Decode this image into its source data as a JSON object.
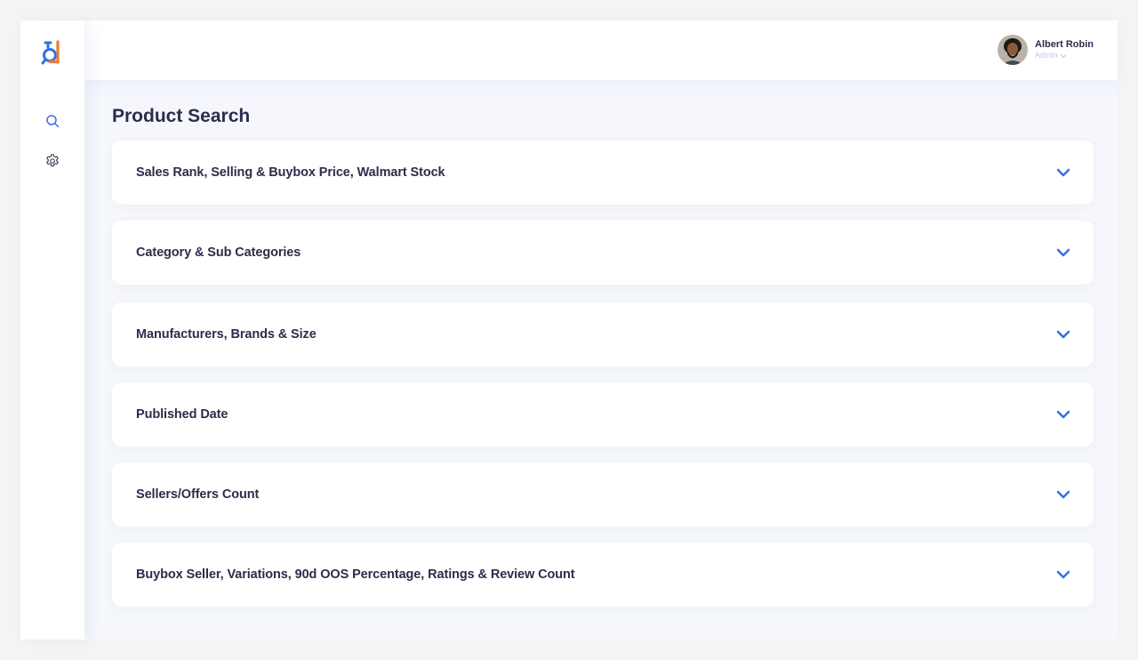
{
  "app": {
    "logo": "logo-icon",
    "brand_colors": {
      "primary": "#2f6fe8",
      "accent": "#f07a2a"
    }
  },
  "sidebar": {
    "items": [
      {
        "icon": "search-icon"
      },
      {
        "icon": "gear-icon"
      }
    ]
  },
  "header": {
    "user": {
      "name": "Albert Robin",
      "role": "Admin",
      "avatar": "avatar-icon"
    }
  },
  "page": {
    "title": "Product Search",
    "panels": [
      {
        "label": "Sales Rank, Selling & Buybox Price, Walmart Stock"
      },
      {
        "label": "Category & Sub Categories"
      },
      {
        "label": "Manufacturers, Brands & Size"
      },
      {
        "label": "Published Date"
      },
      {
        "label": "Sellers/Offers Count"
      },
      {
        "label": "Buybox Seller, Variations, 90d OOS Percentage, Ratings & Review Count"
      }
    ]
  },
  "colors": {
    "chevron": "#3c6ee6",
    "text_dark": "#2c2d4a",
    "page_bg": "#f5f7fc"
  }
}
